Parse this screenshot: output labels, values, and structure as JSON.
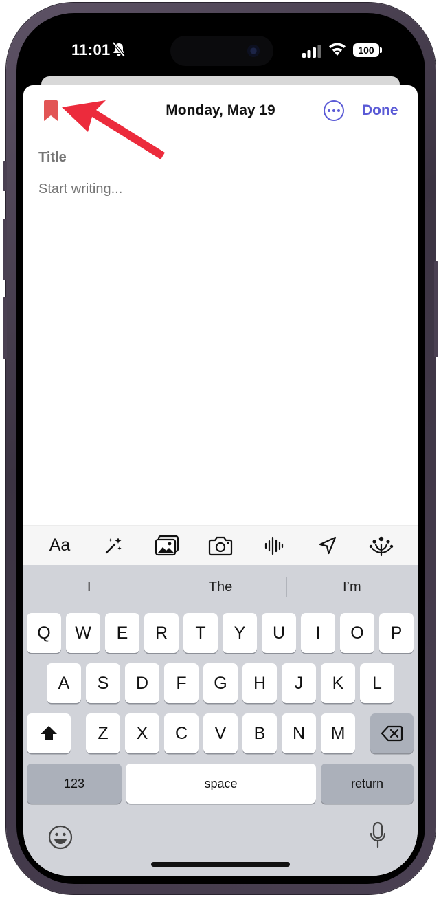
{
  "status_bar": {
    "time": "11:01",
    "battery": "100"
  },
  "editor": {
    "date": "Monday, May 19",
    "done_label": "Done",
    "title_placeholder": "Title",
    "body_placeholder": "Start writing..."
  },
  "toolbar": {
    "format_label": "Aa"
  },
  "keyboard": {
    "suggestions": [
      "I",
      "The",
      "I’m"
    ],
    "row1": [
      "Q",
      "W",
      "E",
      "R",
      "T",
      "Y",
      "U",
      "I",
      "O",
      "P"
    ],
    "row2": [
      "A",
      "S",
      "D",
      "F",
      "G",
      "H",
      "J",
      "K",
      "L"
    ],
    "row3": [
      "Z",
      "X",
      "C",
      "V",
      "B",
      "N",
      "M"
    ],
    "numbers_label": "123",
    "space_label": "space",
    "return_label": "return"
  },
  "colors": {
    "accent": "#5b5bd6",
    "bookmark": "#e25555",
    "annotation_arrow": "#ec2b3c"
  }
}
